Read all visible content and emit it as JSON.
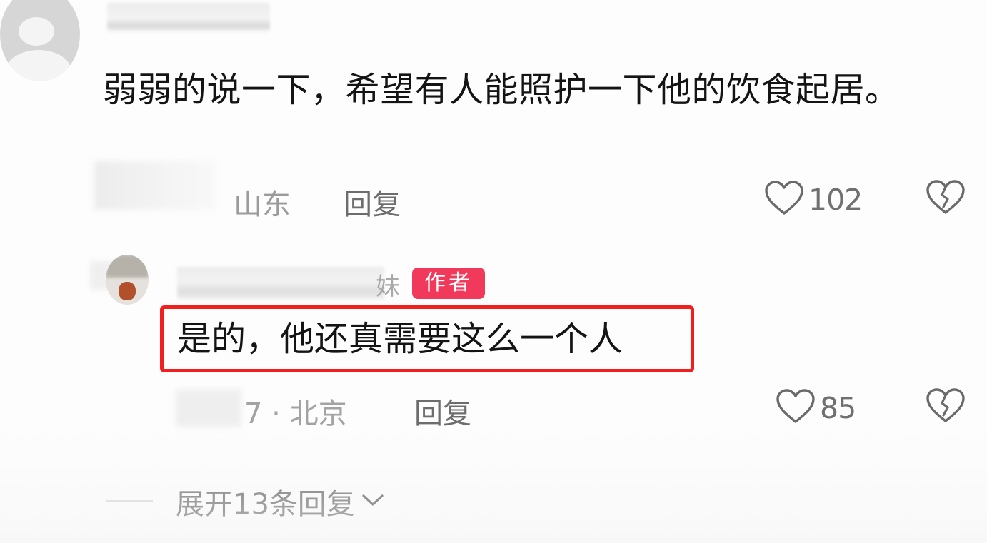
{
  "comment": {
    "text": "弱弱的说一下，希望有人能照护一下他的饮食起居。",
    "location": "山东",
    "reply_label": "回复",
    "like_count": "102"
  },
  "author_reply": {
    "name_visible_tail": "妹",
    "badge": "作者",
    "text": "是的，他还真需要这么一个人",
    "date_location": "7 · 北京",
    "reply_label": "回复",
    "like_count": "85"
  },
  "expand": {
    "label": "展开13条回复"
  },
  "colors": {
    "badge": "#f13a5b",
    "highlight": "#f21f1f"
  },
  "icons": {
    "like": "heart-icon",
    "dislike": "broken-heart-icon",
    "expand": "chevron-down-icon"
  }
}
